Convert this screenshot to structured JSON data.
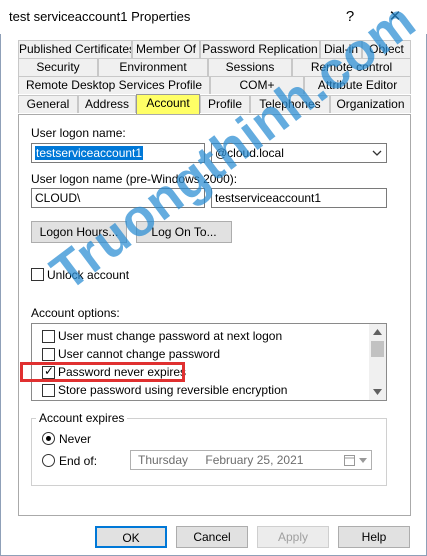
{
  "window": {
    "title": "test serviceaccount1 Properties",
    "help_glyph": "?",
    "close_glyph": "✕"
  },
  "tabs": {
    "row1": [
      "Published Certificates",
      "Member Of",
      "Password Replication",
      "Dial-in",
      "Object"
    ],
    "row2": [
      "Security",
      "Environment",
      "Sessions",
      "Remote control"
    ],
    "row3": [
      "Remote Desktop Services Profile",
      "COM+",
      "Attribute Editor"
    ],
    "row4": [
      "General",
      "Address",
      "Account",
      "Profile",
      "Telephones",
      "Organization"
    ],
    "selected": "Account"
  },
  "account": {
    "logon_name_label": "User logon name:",
    "logon_name_value": "testserviceaccount1",
    "domain_value": "@cloud.local",
    "pre2000_label": "User logon name (pre-Windows 2000):",
    "pre2000_domain": "CLOUD\\",
    "pre2000_value": "testserviceaccount1",
    "logon_hours_button": "Logon Hours...",
    "log_on_to_button": "Log On To...",
    "unlock_label": "Unlock account",
    "options_label": "Account options:",
    "options": [
      {
        "label": "User must change password at next logon",
        "checked": false
      },
      {
        "label": "User cannot change password",
        "checked": false
      },
      {
        "label": "Password never expires",
        "checked": true
      },
      {
        "label": "Store password using reversible encryption",
        "checked": false
      }
    ],
    "expires_label": "Account expires",
    "never_label": "Never",
    "end_of_label": "End of:",
    "end_of_day": "Thursday",
    "end_of_date": "February  25, 2021"
  },
  "footer": {
    "ok": "OK",
    "cancel": "Cancel",
    "apply": "Apply",
    "help": "Help"
  },
  "watermark": "Truongthinh.com",
  "colors": {
    "tab_highlight": "#ffff66",
    "selection": "#0078d7",
    "annotation_red": "#e03030",
    "watermark": "#288cd2"
  }
}
